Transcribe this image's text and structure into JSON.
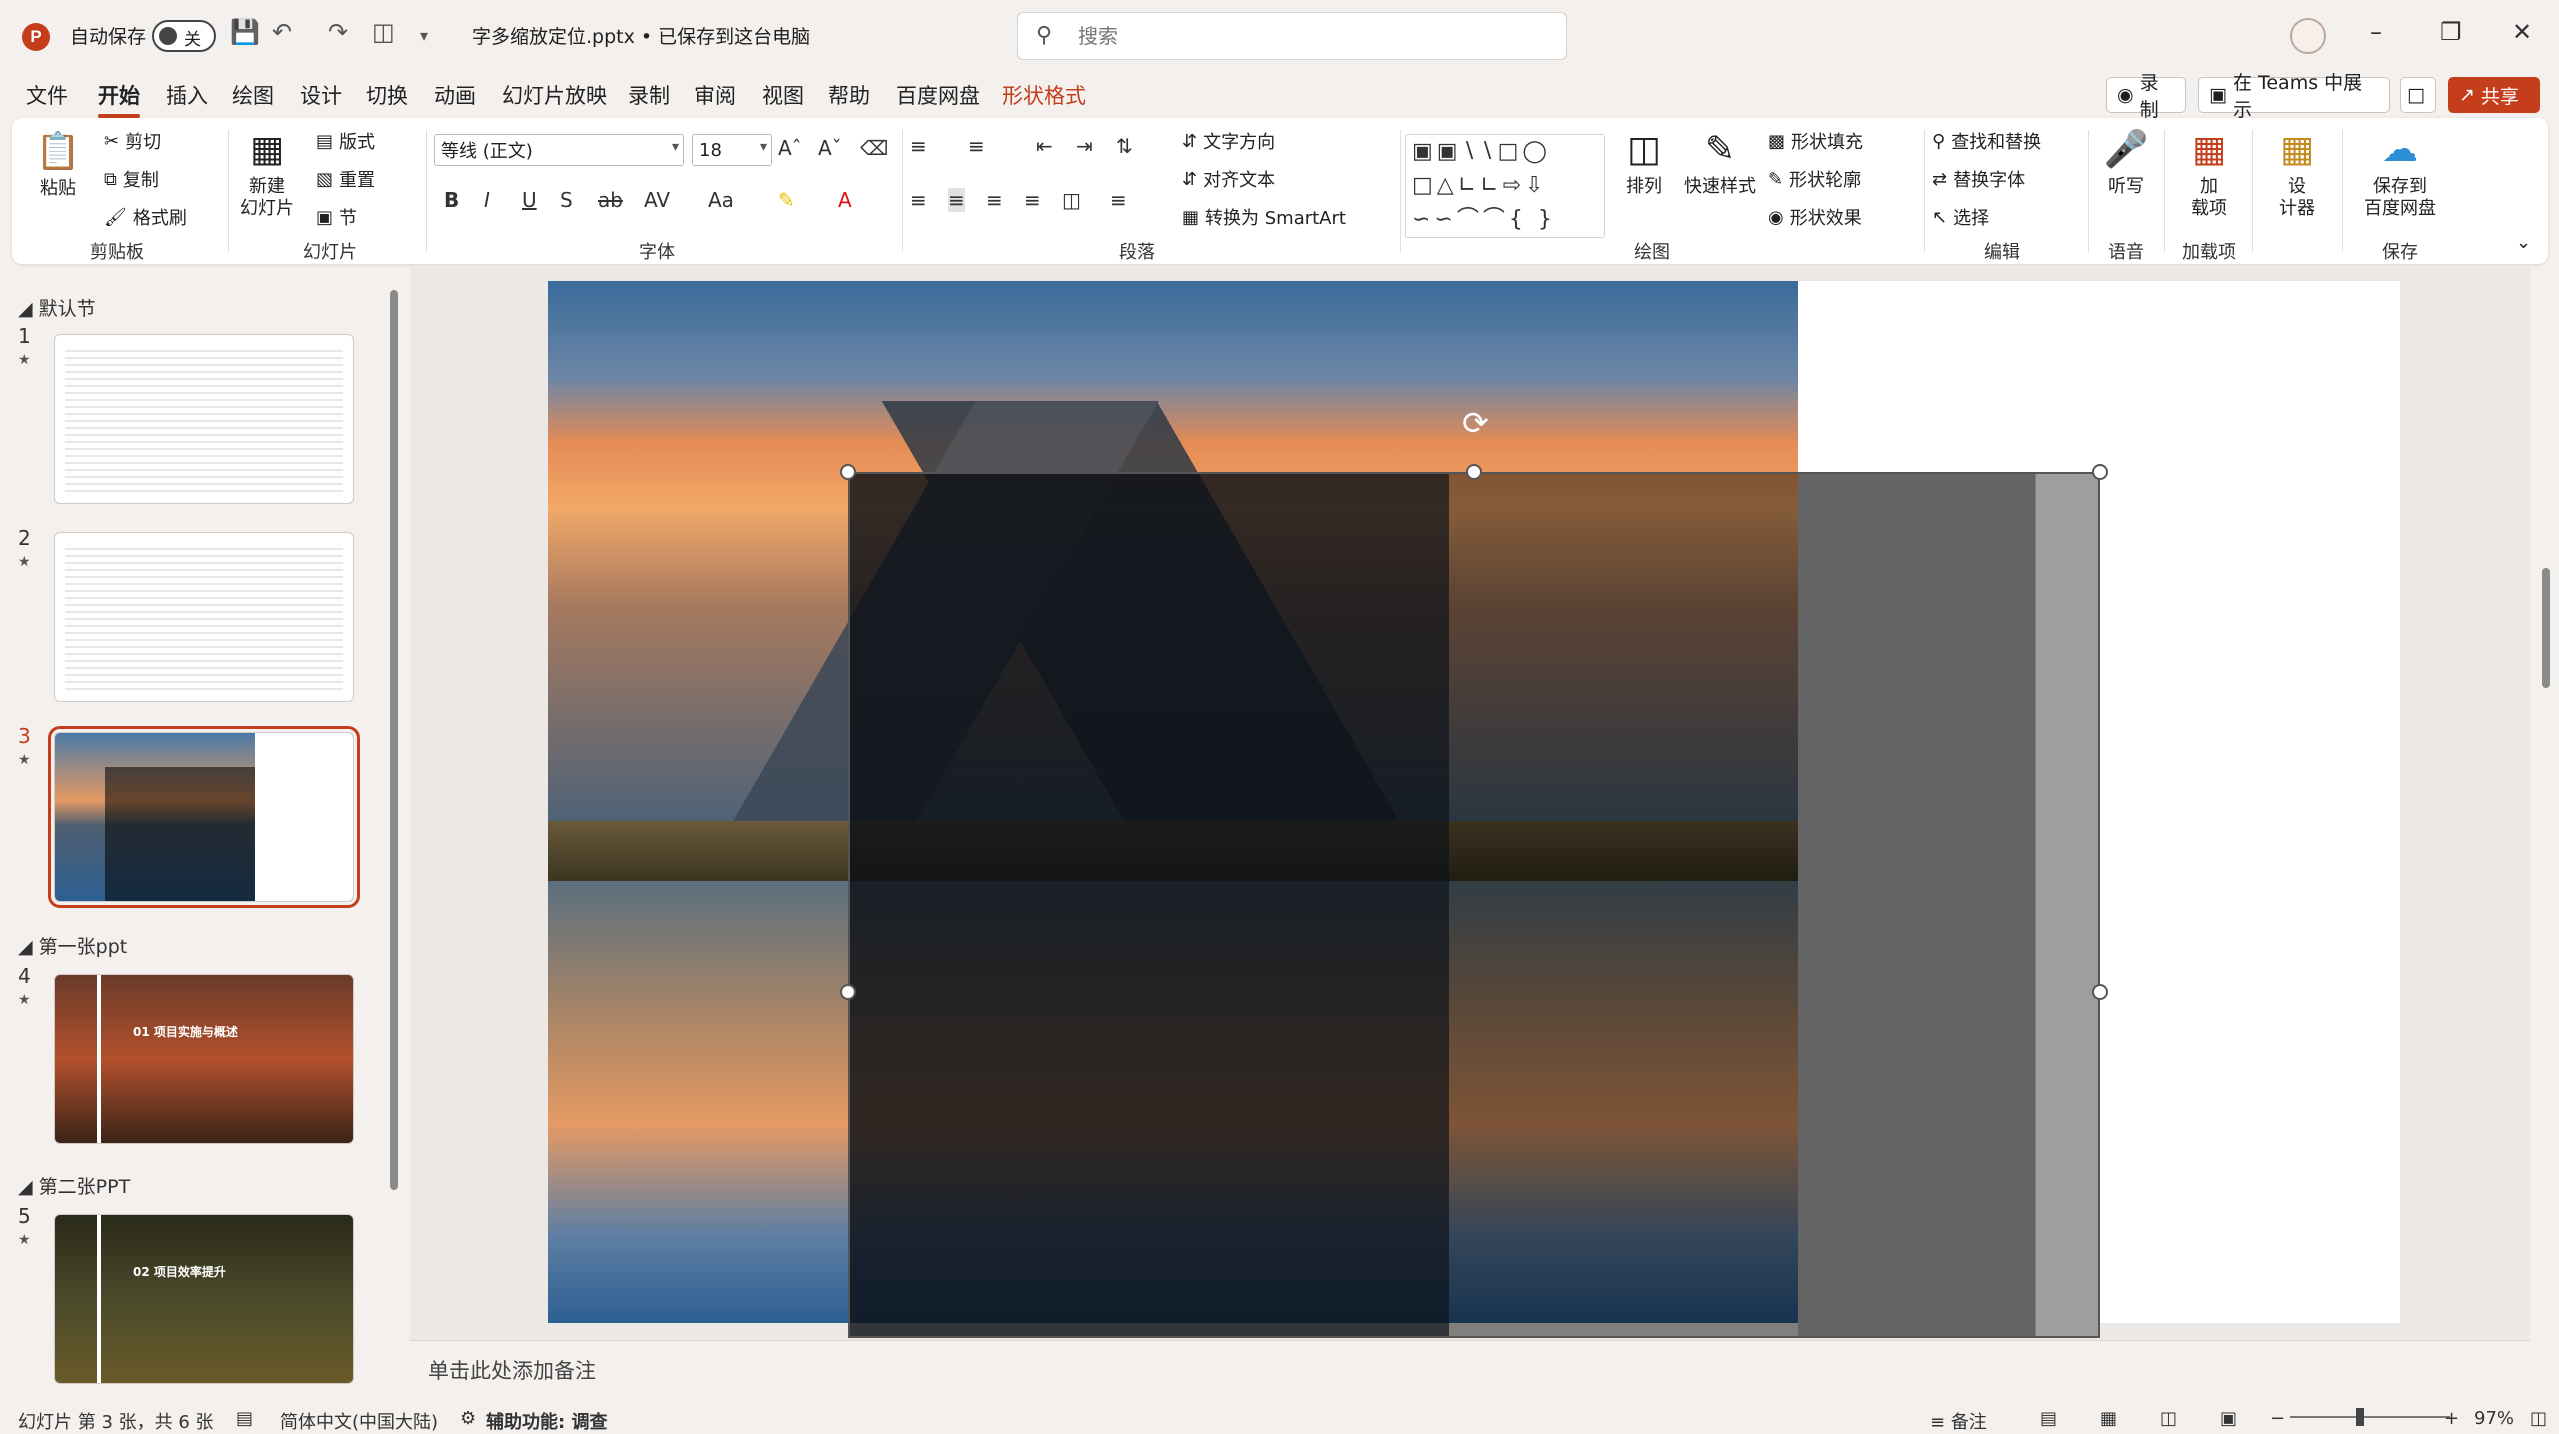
{
  "titlebar": {
    "app_icon": "P",
    "autosave_label": "自动保存",
    "autosave_state": "关",
    "document_title": "字多缩放定位.pptx • 已保存到这台电脑",
    "search_placeholder": "搜索",
    "icons": [
      "save-icon",
      "undo-icon",
      "redo-icon",
      "present-icon",
      "customize-icon"
    ]
  },
  "menu": {
    "tabs": [
      "文件",
      "开始",
      "插入",
      "绘图",
      "设计",
      "切换",
      "动画",
      "幻灯片放映",
      "录制",
      "审阅",
      "视图",
      "帮助",
      "百度网盘",
      "形状格式"
    ],
    "active_tab": "开始",
    "record_label": "录制",
    "teams_label": "在 Teams 中展示",
    "share_label": "共享"
  },
  "ribbon": {
    "clipboard": {
      "label": "剪贴板",
      "paste": "粘贴",
      "cut": "剪切",
      "copy": "复制",
      "format_painter": "格式刷"
    },
    "slides": {
      "label": "幻灯片",
      "new_slide": "新建",
      "new_slide2": "幻灯片",
      "layout": "版式",
      "reset": "重置",
      "section": "节"
    },
    "font": {
      "label": "字体",
      "font_name": "等线 (正文)",
      "font_size": "18",
      "bold": "B",
      "italic": "I",
      "underline": "U",
      "shadow": "S",
      "strike": "ab",
      "spacing": "AV",
      "case": "Aa"
    },
    "paragraph": {
      "label": "段落",
      "text_direction": "文字方向",
      "align_text": "对齐文本",
      "smartart": "转换为 SmartArt"
    },
    "drawing": {
      "label": "绘图",
      "arrange": "排列",
      "quick_styles": "快速样式",
      "fill": "形状填充",
      "outline": "形状轮廓",
      "effects": "形状效果"
    },
    "editing": {
      "label": "编辑",
      "find_replace": "查找和替换",
      "replace_font": "替换字体",
      "select": "选择"
    },
    "voice": {
      "label": "语音",
      "dictate": "听写"
    },
    "addins": {
      "label": "加载项",
      "addins_btn_1": "加",
      "addins_btn_2": "载项"
    },
    "designer": {
      "btn_1": "设",
      "btn_2": "计器"
    },
    "save": {
      "label": "保存",
      "save_baidu_1": "保存到",
      "save_baidu_2": "百度网盘"
    }
  },
  "slides_panel": {
    "sections": [
      {
        "title": "默认节"
      },
      {
        "title": "第一张ppt"
      },
      {
        "title": "第二张PPT"
      }
    ],
    "slides": [
      {
        "number": "1"
      },
      {
        "number": "2"
      },
      {
        "number": "3"
      },
      {
        "number": "4",
        "title": "01 项目实施与概述"
      },
      {
        "number": "5",
        "title": "02 项目效率提升"
      }
    ],
    "active_slide": "3"
  },
  "notes": {
    "placeholder": "单击此处添加备注"
  },
  "statusbar": {
    "slide_info": "幻灯片 第 3 张，共 6 张",
    "language": "简体中文(中国大陆)",
    "accessibility": "辅助功能: 调查",
    "notes_btn": "备注",
    "zoom": "97%"
  },
  "colors": {
    "accent": "#c43e1c",
    "background": "#f3f0ee"
  }
}
